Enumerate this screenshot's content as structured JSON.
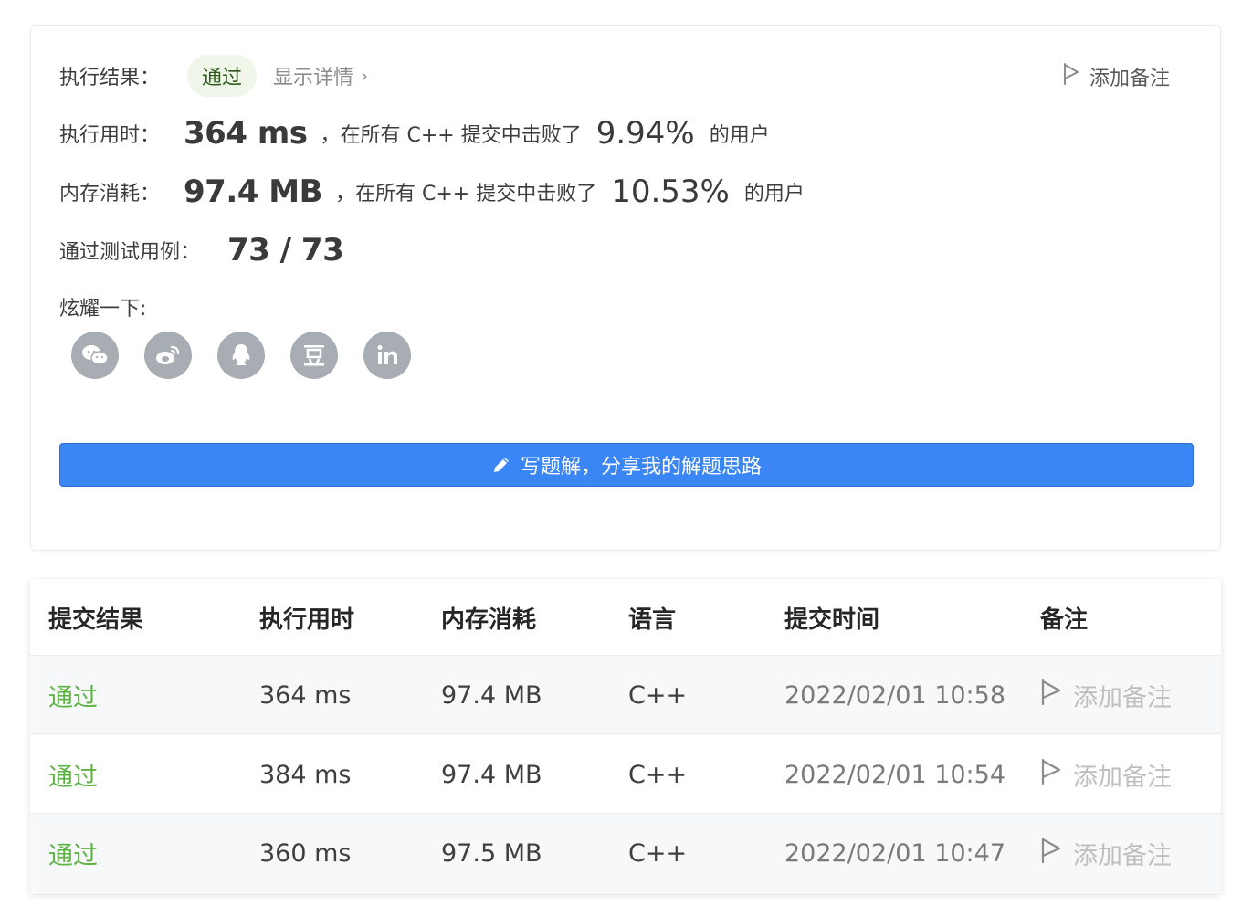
{
  "result": {
    "label": "执行结果：",
    "status": "通过",
    "details_link": "显示详情",
    "details_chevron": "›",
    "add_note": "添加备注"
  },
  "runtime": {
    "label": "执行用时：",
    "value": "364 ms",
    "mid": "，在所有 C++ 提交中击败了",
    "percent": "9.94%",
    "suffix": "的用户"
  },
  "memory": {
    "label": "内存消耗：",
    "value": "97.4 MB",
    "mid": "，在所有 C++ 提交中击败了",
    "percent": "10.53%",
    "suffix": "的用户"
  },
  "testcases": {
    "label": "通过测试用例：",
    "value": "73 / 73"
  },
  "share": {
    "label": "炫耀一下:",
    "icons": [
      "wechat-icon",
      "weibo-icon",
      "qq-icon",
      "douban-icon",
      "linkedin-icon"
    ]
  },
  "write_button": "写题解，分享我的解题思路",
  "table": {
    "headers": [
      "提交结果",
      "执行用时",
      "内存消耗",
      "语言",
      "提交时间",
      "备注"
    ],
    "rows": [
      {
        "status": "通过",
        "runtime": "364 ms",
        "memory": "97.4 MB",
        "lang": "C++",
        "time": "2022/02/01 10:58",
        "note": "添加备注"
      },
      {
        "status": "通过",
        "runtime": "384 ms",
        "memory": "97.4 MB",
        "lang": "C++",
        "time": "2022/02/01 10:54",
        "note": "添加备注"
      },
      {
        "status": "通过",
        "runtime": "360 ms",
        "memory": "97.5 MB",
        "lang": "C++",
        "time": "2022/02/01 10:47",
        "note": "添加备注"
      }
    ]
  },
  "colors": {
    "accent_blue": "#3b86f5",
    "success_green": "#5cb342",
    "badge_bg": "#f0f6ea",
    "icon_gray": "#a8acb3"
  }
}
